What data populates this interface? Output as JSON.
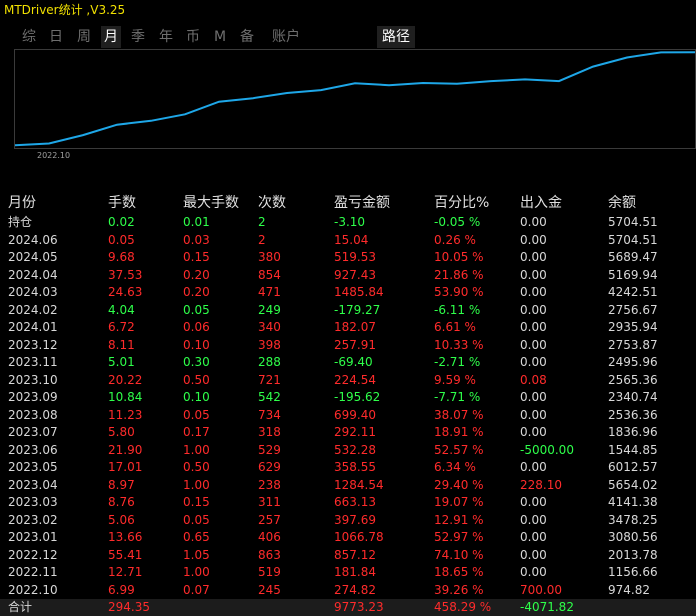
{
  "title": "MTDriver统计 ,V3.25",
  "tabs": [
    {
      "label": "综",
      "active": false
    },
    {
      "label": "日",
      "active": false
    },
    {
      "label": "周",
      "active": false
    },
    {
      "label": "月",
      "active": true
    },
    {
      "label": "季",
      "active": false
    },
    {
      "label": "年",
      "active": false
    },
    {
      "label": "币",
      "active": false
    },
    {
      "label": "M",
      "active": false
    },
    {
      "label": "备",
      "active": false
    },
    {
      "label": "账户",
      "active": false
    }
  ],
  "path_button": "路径",
  "colors": {
    "positive": "#ff2b2b",
    "negative": "#2eff4a",
    "line": "#1ea7e8",
    "title": "#f0e000"
  },
  "chart_data": {
    "type": "line",
    "x_tick_label": "2022.10",
    "x": [
      "2022.10",
      "2022.11",
      "2022.12",
      "2023.01",
      "2023.02",
      "2023.03",
      "2023.04",
      "2023.05",
      "2023.06",
      "2023.07",
      "2023.08",
      "2023.09",
      "2023.10",
      "2023.11",
      "2023.12",
      "2024.01",
      "2024.02",
      "2024.03",
      "2024.04",
      "2024.05",
      "2024.06"
    ],
    "y": [
      274.82,
      456.66,
      1313.78,
      2380.56,
      2778.25,
      3441.38,
      4725.76,
      5084.31,
      5616.59,
      5908.7,
      6608.1,
      6412.48,
      6636.99,
      6567.59,
      6825.5,
      7007.57,
      6828.3,
      8313.1,
      9240.53,
      9760.06,
      9775.1
    ],
    "ylim": [
      0,
      9800
    ]
  },
  "table": {
    "headers": [
      "月份",
      "手数",
      "最大手数",
      "次数",
      "盈亏金额",
      "百分比%",
      "出入金",
      "余额"
    ],
    "rows": [
      {
        "cells": [
          "持仓",
          "0.02",
          "0.01",
          "2",
          "-3.10",
          "-0.05 %",
          "0.00",
          "5704.51"
        ],
        "colors": [
          "w",
          "g",
          "g",
          "g",
          "g",
          "g",
          "w",
          "w"
        ]
      },
      {
        "cells": [
          "2024.06",
          "0.05",
          "0.03",
          "2",
          "15.04",
          "0.26 %",
          "0.00",
          "5704.51"
        ],
        "colors": [
          "w",
          "r",
          "r",
          "r",
          "r",
          "r",
          "w",
          "w"
        ]
      },
      {
        "cells": [
          "2024.05",
          "9.68",
          "0.15",
          "380",
          "519.53",
          "10.05 %",
          "0.00",
          "5689.47"
        ],
        "colors": [
          "w",
          "r",
          "r",
          "r",
          "r",
          "r",
          "w",
          "w"
        ]
      },
      {
        "cells": [
          "2024.04",
          "37.53",
          "0.20",
          "854",
          "927.43",
          "21.86 %",
          "0.00",
          "5169.94"
        ],
        "colors": [
          "w",
          "r",
          "r",
          "r",
          "r",
          "r",
          "w",
          "w"
        ]
      },
      {
        "cells": [
          "2024.03",
          "24.63",
          "0.20",
          "471",
          "1485.84",
          "53.90 %",
          "0.00",
          "4242.51"
        ],
        "colors": [
          "w",
          "r",
          "r",
          "r",
          "r",
          "r",
          "w",
          "w"
        ]
      },
      {
        "cells": [
          "2024.02",
          "4.04",
          "0.05",
          "249",
          "-179.27",
          "-6.11 %",
          "0.00",
          "2756.67"
        ],
        "colors": [
          "w",
          "g",
          "g",
          "g",
          "g",
          "g",
          "w",
          "w"
        ]
      },
      {
        "cells": [
          "2024.01",
          "6.72",
          "0.06",
          "340",
          "182.07",
          "6.61 %",
          "0.00",
          "2935.94"
        ],
        "colors": [
          "w",
          "r",
          "r",
          "r",
          "r",
          "r",
          "w",
          "w"
        ]
      },
      {
        "cells": [
          "2023.12",
          "8.11",
          "0.10",
          "398",
          "257.91",
          "10.33 %",
          "0.00",
          "2753.87"
        ],
        "colors": [
          "w",
          "r",
          "r",
          "r",
          "r",
          "r",
          "w",
          "w"
        ]
      },
      {
        "cells": [
          "2023.11",
          "5.01",
          "0.30",
          "288",
          "-69.40",
          "-2.71 %",
          "0.00",
          "2495.96"
        ],
        "colors": [
          "w",
          "g",
          "g",
          "g",
          "g",
          "g",
          "w",
          "w"
        ]
      },
      {
        "cells": [
          "2023.10",
          "20.22",
          "0.50",
          "721",
          "224.54",
          "9.59 %",
          "0.08",
          "2565.36"
        ],
        "colors": [
          "w",
          "r",
          "r",
          "r",
          "r",
          "r",
          "r",
          "w"
        ]
      },
      {
        "cells": [
          "2023.09",
          "10.84",
          "0.10",
          "542",
          "-195.62",
          "-7.71 %",
          "0.00",
          "2340.74"
        ],
        "colors": [
          "w",
          "g",
          "g",
          "g",
          "g",
          "g",
          "w",
          "w"
        ]
      },
      {
        "cells": [
          "2023.08",
          "11.23",
          "0.05",
          "734",
          "699.40",
          "38.07 %",
          "0.00",
          "2536.36"
        ],
        "colors": [
          "w",
          "r",
          "r",
          "r",
          "r",
          "r",
          "w",
          "w"
        ]
      },
      {
        "cells": [
          "2023.07",
          "5.80",
          "0.17",
          "318",
          "292.11",
          "18.91 %",
          "0.00",
          "1836.96"
        ],
        "colors": [
          "w",
          "r",
          "r",
          "r",
          "r",
          "r",
          "w",
          "w"
        ]
      },
      {
        "cells": [
          "2023.06",
          "21.90",
          "1.00",
          "529",
          "532.28",
          "52.57 %",
          "-5000.00",
          "1544.85"
        ],
        "colors": [
          "w",
          "r",
          "r",
          "r",
          "r",
          "r",
          "g",
          "w"
        ]
      },
      {
        "cells": [
          "2023.05",
          "17.01",
          "0.50",
          "629",
          "358.55",
          "6.34 %",
          "0.00",
          "6012.57"
        ],
        "colors": [
          "w",
          "r",
          "r",
          "r",
          "r",
          "r",
          "w",
          "w"
        ]
      },
      {
        "cells": [
          "2023.04",
          "8.97",
          "1.00",
          "238",
          "1284.54",
          "29.40 %",
          "228.10",
          "5654.02"
        ],
        "colors": [
          "w",
          "r",
          "r",
          "r",
          "r",
          "r",
          "r",
          "w"
        ]
      },
      {
        "cells": [
          "2023.03",
          "8.76",
          "0.15",
          "311",
          "663.13",
          "19.07 %",
          "0.00",
          "4141.38"
        ],
        "colors": [
          "w",
          "r",
          "r",
          "r",
          "r",
          "r",
          "w",
          "w"
        ]
      },
      {
        "cells": [
          "2023.02",
          "5.06",
          "0.05",
          "257",
          "397.69",
          "12.91 %",
          "0.00",
          "3478.25"
        ],
        "colors": [
          "w",
          "r",
          "r",
          "r",
          "r",
          "r",
          "w",
          "w"
        ]
      },
      {
        "cells": [
          "2023.01",
          "13.66",
          "0.65",
          "406",
          "1066.78",
          "52.97 %",
          "0.00",
          "3080.56"
        ],
        "colors": [
          "w",
          "r",
          "r",
          "r",
          "r",
          "r",
          "w",
          "w"
        ]
      },
      {
        "cells": [
          "2022.12",
          "55.41",
          "1.05",
          "863",
          "857.12",
          "74.10 %",
          "0.00",
          "2013.78"
        ],
        "colors": [
          "w",
          "r",
          "r",
          "r",
          "r",
          "r",
          "w",
          "w"
        ]
      },
      {
        "cells": [
          "2022.11",
          "12.71",
          "1.00",
          "519",
          "181.84",
          "18.65 %",
          "0.00",
          "1156.66"
        ],
        "colors": [
          "w",
          "r",
          "r",
          "r",
          "r",
          "r",
          "w",
          "w"
        ]
      },
      {
        "cells": [
          "2022.10",
          "6.99",
          "0.07",
          "245",
          "274.82",
          "39.26 %",
          "700.00",
          "974.82"
        ],
        "colors": [
          "w",
          "r",
          "r",
          "r",
          "r",
          "r",
          "r",
          "w"
        ]
      }
    ],
    "total": {
      "cells": [
        "合计",
        "294.35",
        "",
        "",
        "9773.23",
        "458.29 %",
        "-4071.82",
        ""
      ],
      "colors": [
        "w",
        "r",
        "w",
        "w",
        "r",
        "r",
        "g",
        "w"
      ]
    }
  }
}
